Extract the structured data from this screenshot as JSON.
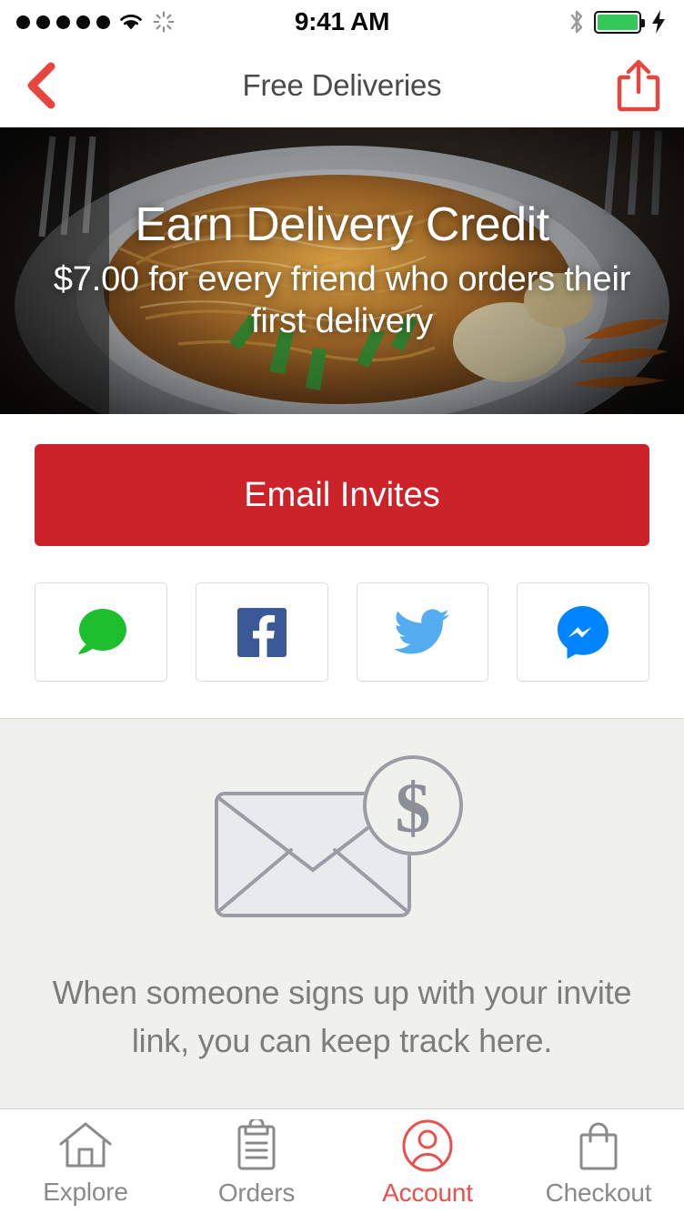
{
  "status_bar": {
    "signal_dots": 5,
    "wifi_icon": "wifi-icon",
    "activity_icon": "activity-spinner-icon",
    "time": "9:41 AM",
    "bluetooth_icon": "bluetooth-icon",
    "battery_icon": "battery-full-icon",
    "battery_level": 100,
    "charging_icon": "lightning-bolt-icon"
  },
  "nav": {
    "back_icon": "chevron-left-icon",
    "title": "Free Deliveries",
    "share_icon": "share-upload-icon"
  },
  "hero": {
    "image": "noodle-dish-photo",
    "title": "Earn Delivery Credit",
    "subtitle": "$7.00 for every friend who orders their first delivery",
    "amount": "$7.00"
  },
  "share": {
    "email_button_label": "Email Invites",
    "social_buttons": [
      {
        "name": "sms-share-button",
        "icon": "message-bubble-icon",
        "color": "#1DBF2E"
      },
      {
        "name": "facebook-share-button",
        "icon": "facebook-icon",
        "color": "#3B5998"
      },
      {
        "name": "twitter-share-button",
        "icon": "twitter-bird-icon",
        "color": "#55ACEE"
      },
      {
        "name": "messenger-share-button",
        "icon": "messenger-icon",
        "color": "#0084FF"
      }
    ]
  },
  "empty_state": {
    "illustration": "envelope-with-dollar-badge-icon",
    "message": "When someone signs up with your invite link, you can keep track here."
  },
  "tabs": [
    {
      "label": "Explore",
      "icon": "home-icon",
      "active": false
    },
    {
      "label": "Orders",
      "icon": "clipboard-icon",
      "active": false
    },
    {
      "label": "Account",
      "icon": "person-circle-icon",
      "active": true
    },
    {
      "label": "Checkout",
      "icon": "shopping-bag-icon",
      "active": false
    }
  ],
  "colors": {
    "accent_red": "#E8524E",
    "button_red": "#CC2229",
    "panel_gray": "#F0F1EC",
    "text_gray": "#7d7d7d"
  }
}
